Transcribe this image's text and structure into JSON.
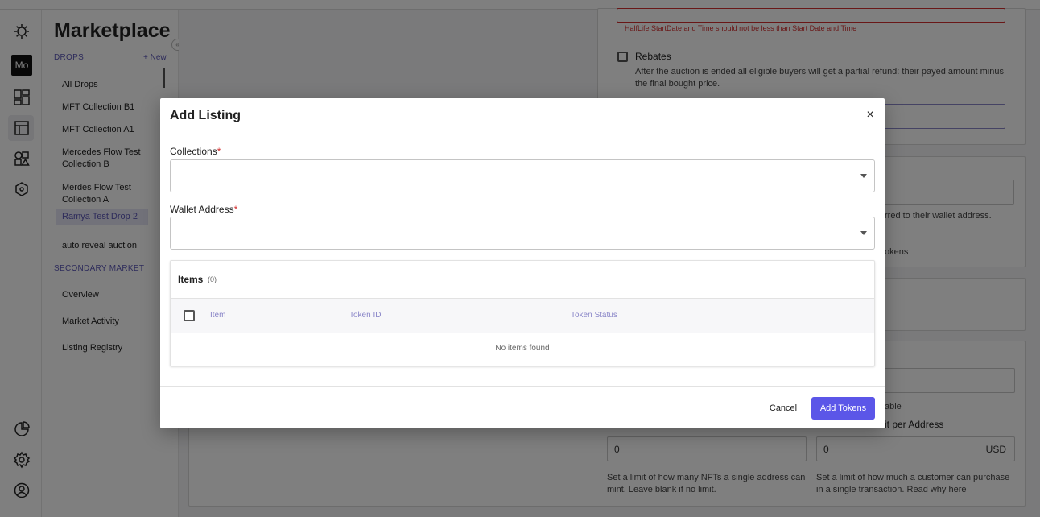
{
  "sidebar": {
    "title": "Marketplace",
    "drops_header": "DROPS",
    "new_label": "+ New",
    "drops": [
      "All Drops",
      "MFT Collection B1",
      "MFT Collection A1",
      "Mercedes Flow Test Collection B",
      "Merdes Flow Test Collection A",
      "Ramya Test Drop 2",
      "auto reveal auction"
    ],
    "secondary_header": "SECONDARY MARKET",
    "secondary": [
      "Overview",
      "Market Activity",
      "Listing Registry"
    ]
  },
  "rail": {
    "workspace_initials": "Mo"
  },
  "background": {
    "error_text": "HalfLife StartDate and Time should not be less than Start Date and Time",
    "rebates_label": "Rebates",
    "rebates_help": "After the auction is ended all eligible buyers will get a partial refund: their payed amount minus the final bought price.",
    "fragment_wallet": "rred to their wallet address.",
    "fragment_tokens": "okens",
    "fragment_able": "able",
    "limit_label_right": "it per Address",
    "mint_limit_value": "0",
    "spend_limit_value": "0",
    "currency": "USD",
    "mint_help": "Set a limit of how many NFTs a single address can mint. Leave blank if no limit.",
    "spend_help": "Set a limit of how much a customer can purchase in a single transaction. Read why here"
  },
  "modal": {
    "title": "Add Listing",
    "collections_label": "Collections",
    "wallet_label": "Wallet Address",
    "required_mark": "*",
    "items_title": "Items",
    "items_count": "(0)",
    "columns": [
      "Item",
      "Token ID",
      "Token Status"
    ],
    "empty_text": "No items found",
    "cancel_label": "Cancel",
    "submit_label": "Add Tokens"
  }
}
